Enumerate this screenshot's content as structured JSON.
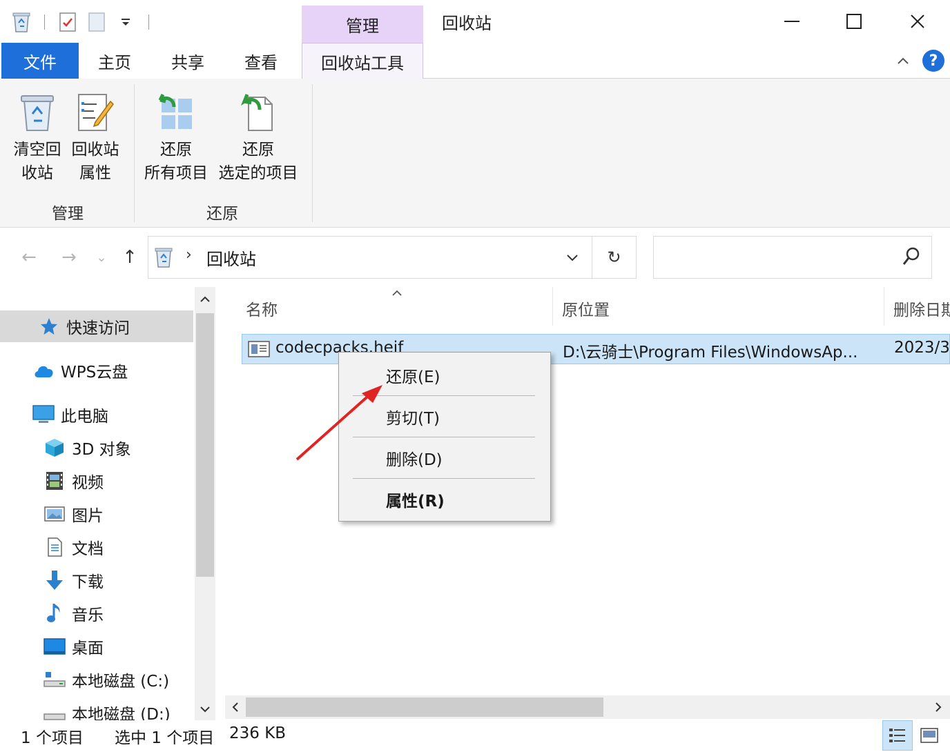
{
  "titlebar": {
    "context_tab_header": "管理",
    "window_title": "回收站",
    "minimize": "—",
    "maximize": "☐",
    "close": "✕"
  },
  "tabs": {
    "file": "文件",
    "home": "主页",
    "share": "共享",
    "view": "查看",
    "recycle_tools": "回收站工具",
    "collapse": "^",
    "help": "?"
  },
  "ribbon": {
    "empty_bin_l1": "清空回",
    "empty_bin_l2": "收站",
    "bin_props_l1": "回收站",
    "bin_props_l2": "属性",
    "restore_all_l1": "还原",
    "restore_all_l2": "所有项目",
    "restore_sel_l1": "还原",
    "restore_sel_l2": "选定的项目",
    "group_manage": "管理",
    "group_restore": "还原"
  },
  "address": {
    "back": "←",
    "forward": "→",
    "recent": "⌄",
    "up": "↑",
    "chevron": "›",
    "location": "回收站",
    "dropdown": "⌄",
    "refresh": "↻"
  },
  "navpane": {
    "items": [
      {
        "label": "快速访问"
      },
      {
        "label": "WPS云盘"
      },
      {
        "label": "此电脑"
      },
      {
        "label": "3D 对象"
      },
      {
        "label": "视频"
      },
      {
        "label": "图片"
      },
      {
        "label": "文档"
      },
      {
        "label": "下载"
      },
      {
        "label": "音乐"
      },
      {
        "label": "桌面"
      },
      {
        "label": "本地磁盘 (C:)"
      },
      {
        "label": "本地磁盘 (D:)"
      }
    ],
    "scroll_up": "^",
    "scroll_down": "⌄"
  },
  "filelist": {
    "sort_indicator": "^",
    "columns": [
      "名称",
      "原位置",
      "删除日期"
    ],
    "rows": [
      {
        "name": "codecpacks.heif",
        "location": "D:\\云骑士\\Program Files\\WindowsAp...",
        "deleted": "2023/3"
      }
    ]
  },
  "context_menu": {
    "restore": "还原(E)",
    "cut": "剪切(T)",
    "delete": "删除(D)",
    "properties": "属性(R)"
  },
  "hscroll": {
    "left": "<",
    "right": ">"
  },
  "status": {
    "items": "1 个项目",
    "selected": "选中 1 个项目",
    "size": "236 KB"
  },
  "colors": {
    "accent": "#1e6fd9",
    "context_tab": "#e6d3f7",
    "selection": "#cce4f7",
    "arrow": "#e02424"
  }
}
